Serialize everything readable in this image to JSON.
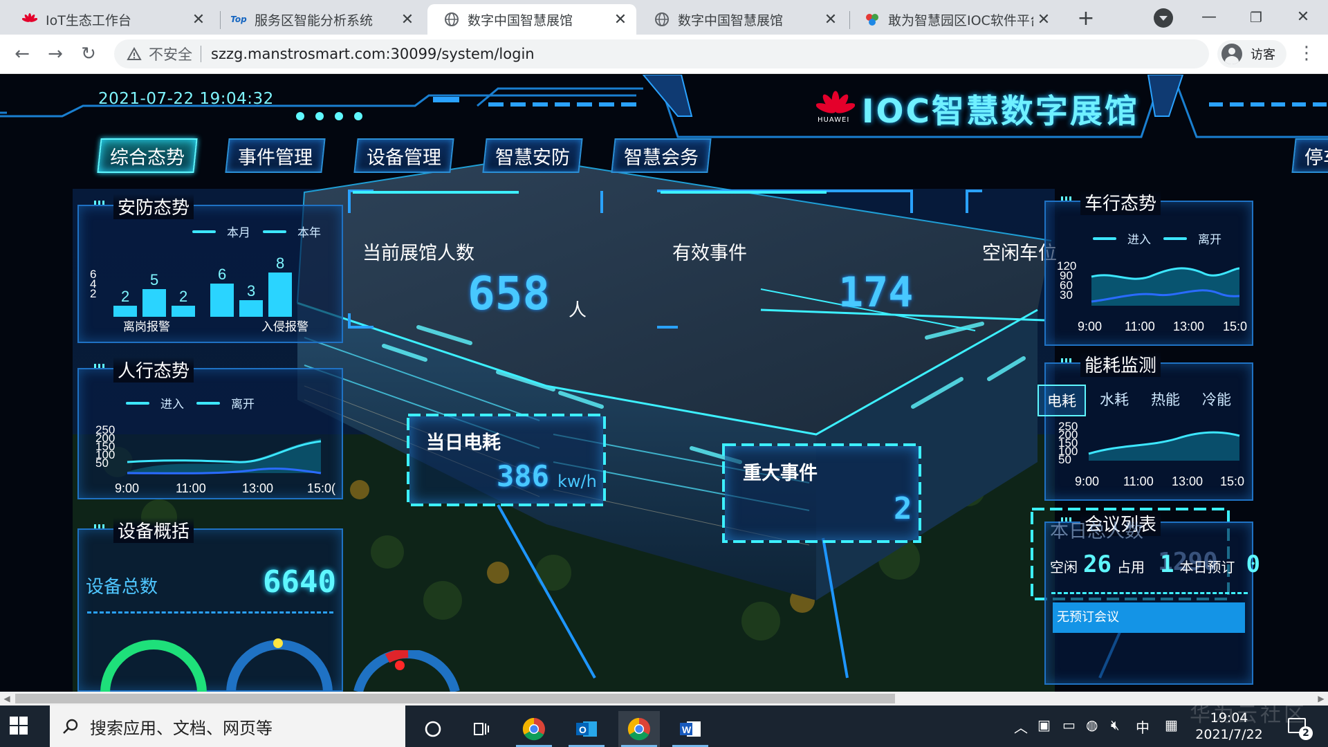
{
  "browser": {
    "tabs": [
      {
        "title": "IoT生态工作台",
        "favicon": "huawei-icon",
        "active": false
      },
      {
        "title": "服务区智能分析系统",
        "favicon": "top-icon",
        "active": false
      },
      {
        "title": "数字中国智慧展馆",
        "favicon": "globe-icon",
        "active": true
      },
      {
        "title": "数字中国智慧展馆",
        "favicon": "globe-icon",
        "active": false
      },
      {
        "title": "敢为智慧园区IOC软件平台",
        "favicon": "pinwheel-icon",
        "active": false
      }
    ],
    "insecure_label": "不安全",
    "url": "szzg.manstrosmart.com:30099/system/login",
    "profile_label": "访客"
  },
  "dashboard": {
    "datetime": "2021-07-22 19:04:32",
    "brand_title": "IOC智慧数字展馆",
    "brand_sub": "HUAWEI",
    "nav_tabs": [
      "综合态势",
      "事件管理",
      "设备管理",
      "智慧安防",
      "智慧会务",
      "停车"
    ],
    "active_nav": 0,
    "colors": {
      "accent": "#5ff7ff",
      "panel_border": "#1f72c4",
      "value": "#48c8ff",
      "bar": "#2ad4ff"
    },
    "security": {
      "title": "安防态势",
      "legend": [
        "本月",
        "本年"
      ],
      "categories": [
        "离岗报警",
        "入侵报警"
      ],
      "y_ticks": [
        "6",
        "4",
        "2"
      ],
      "bar_values": [
        2,
        5,
        2,
        6,
        3,
        8
      ]
    },
    "visitors": {
      "label": "当前展馆人数",
      "value": "658",
      "unit": "人"
    },
    "events": {
      "label": "有效事件",
      "value": "174"
    },
    "parking": {
      "label": "空闲车位"
    },
    "power": {
      "label": "当日电耗",
      "value": "386",
      "unit": "kw/h"
    },
    "major_events": {
      "label": "重大事件",
      "value": "2"
    },
    "pedestrian": {
      "title": "人行态势",
      "legend": [
        "进入",
        "离开"
      ],
      "y_ticks": [
        "250",
        "200",
        "150",
        "100",
        "50"
      ],
      "x_ticks": [
        "9:00",
        "11:00",
        "13:00",
        "15:0("
      ]
    },
    "devices": {
      "title": "设备概括",
      "total_label": "设备总数",
      "total_value": "6640"
    },
    "traffic": {
      "title": "车行态势",
      "legend": [
        "进入",
        "离开"
      ],
      "y_ticks": [
        "120",
        "90",
        "60",
        "30"
      ],
      "x_ticks": [
        "9:00",
        "11:00",
        "13:00",
        "15:0"
      ]
    },
    "energy": {
      "title": "能耗监测",
      "tabs": [
        "电耗",
        "水耗",
        "热能",
        "冷能"
      ],
      "active_tab": 0,
      "y_ticks": [
        "250",
        "200",
        "150",
        "100",
        "50"
      ],
      "x_ticks": [
        "9:00",
        "11:00",
        "13:00",
        "15:0"
      ]
    },
    "meetings": {
      "title": "会议列表",
      "ghost_label": "本日总人数",
      "idle_label": "空闲",
      "idle_value": "26",
      "used_label": "占用",
      "used_value": "1",
      "booked_label": "本日预订",
      "booked_value": "0",
      "empty_text": "无预订会议"
    }
  },
  "taskbar": {
    "search_placeholder": "搜索应用、文档、网页等",
    "tray_ime": "中",
    "time": "19:04",
    "date": "2021/7/22",
    "notification_count": "2",
    "watermark": "华为云社区"
  }
}
